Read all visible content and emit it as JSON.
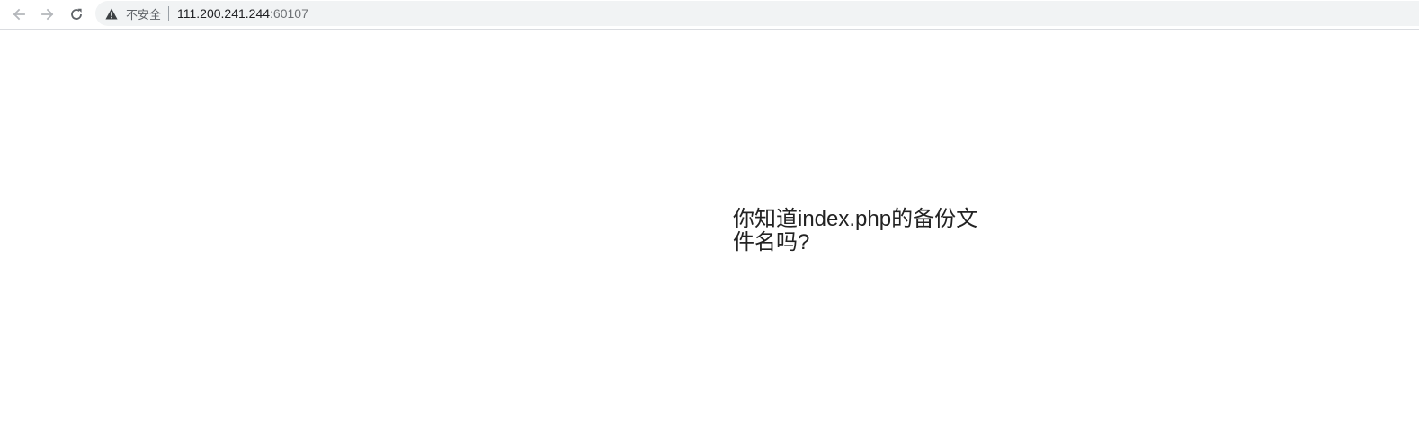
{
  "browser": {
    "security_label": "不安全",
    "url_host": "111.200.241.244",
    "url_port": ":60107",
    "icons": {
      "back": "arrow-left-icon",
      "forward": "arrow-right-icon",
      "reload": "reload-icon",
      "security": "warning-triangle-icon"
    }
  },
  "page": {
    "message": "你知道index.php的备份文件名吗?"
  }
}
